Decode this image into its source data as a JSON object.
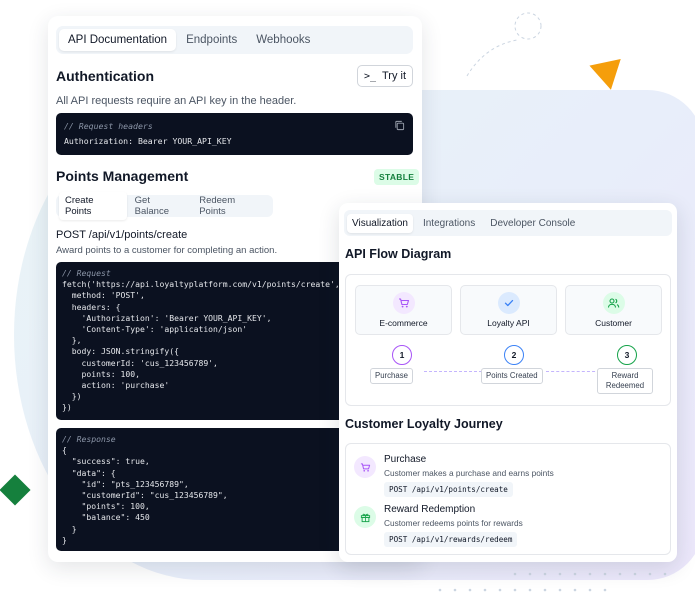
{
  "doc": {
    "tabs": [
      {
        "label": "API Documentation",
        "active": true
      },
      {
        "label": "Endpoints"
      },
      {
        "label": "Webhooks"
      }
    ],
    "auth": {
      "title": "Authentication",
      "try_label": "Try it",
      "description": "All API requests require an API key in the header.",
      "code": [
        "// Request headers",
        "Authorization: Bearer YOUR_API_KEY"
      ]
    },
    "points": {
      "title": "Points Management",
      "badge": "STABLE",
      "subtabs": [
        {
          "label": "Create Points",
          "active": true
        },
        {
          "label": "Get Balance"
        },
        {
          "label": "Redeem Points"
        }
      ],
      "endpoint": "POST /api/v1/points/create",
      "endpoint_desc": "Award points to a customer for completing an action.",
      "request_code": [
        "// Request",
        "fetch('https://api.loyaltyplatform.com/v1/points/create', {",
        "  method: 'POST',",
        "  headers: {",
        "    'Authorization': 'Bearer YOUR_API_KEY',",
        "    'Content-Type': 'application/json'",
        "  },",
        "  body: JSON.stringify({",
        "    customerId: 'cus_123456789',",
        "    points: 100,",
        "    action: 'purchase'",
        "  })",
        "})"
      ],
      "response_code": [
        "// Response",
        "{",
        "  \"success\": true,",
        "  \"data\": {",
        "    \"id\": \"pts_123456789\",",
        "    \"customerId\": \"cus_123456789\",",
        "    \"points\": 100,",
        "    \"balance\": 450",
        "  }",
        "}"
      ]
    }
  },
  "viz": {
    "tabs": [
      {
        "label": "Visualization",
        "active": true
      },
      {
        "label": "Integrations"
      },
      {
        "label": "Developer Console"
      }
    ],
    "flow_title": "API Flow Diagram",
    "nodes": [
      {
        "label": "E-commerce",
        "icon": "cart-icon",
        "color": "#a855f7",
        "bg": "#f3e8ff"
      },
      {
        "label": "Loyalty API",
        "icon": "check-icon",
        "color": "#3b82f6",
        "bg": "#dbeafe"
      },
      {
        "label": "Customer",
        "icon": "users-icon",
        "color": "#16a34a",
        "bg": "#dcfce7"
      }
    ],
    "steps": [
      {
        "num": "1",
        "label": "Purchase",
        "color": "#a855f7"
      },
      {
        "num": "2",
        "label": "Points Created",
        "color": "#3b82f6"
      },
      {
        "num": "3",
        "label": "Reward Redeemed",
        "color": "#16a34a"
      }
    ],
    "journey_title": "Customer Loyalty Journey",
    "journey": [
      {
        "title": "Purchase",
        "desc": "Customer makes a purchase and earns points",
        "code": "POST /api/v1/points/create",
        "icon": "cart-icon",
        "color": "#a855f7",
        "bg": "#f3e8ff"
      },
      {
        "title": "Reward Redemption",
        "desc": "Customer redeems points for rewards",
        "code": "POST /api/v1/rewards/redeem",
        "icon": "gift-icon",
        "color": "#16a34a",
        "bg": "#dcfce7"
      }
    ]
  }
}
